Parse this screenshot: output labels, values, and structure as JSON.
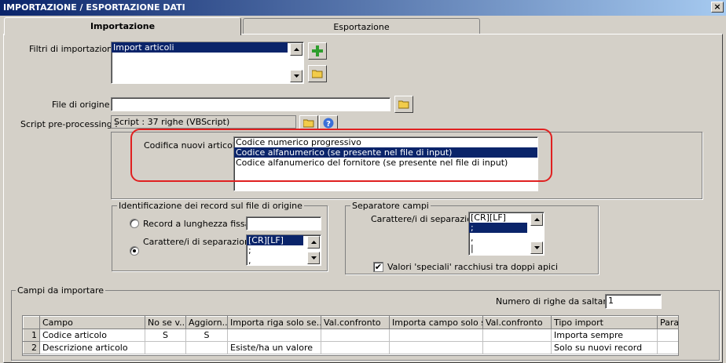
{
  "window": {
    "title": "IMPORTAZIONE / ESPORTAZIONE DATI",
    "close_glyph": "×"
  },
  "tabs": [
    {
      "label": "Importazione",
      "active": true
    },
    {
      "label": "Esportazione",
      "active": false
    }
  ],
  "import_filters": {
    "label": "Filtri di importazione :",
    "items": [
      "Import articoli"
    ],
    "selected_index": 0
  },
  "source_file": {
    "label": "File di origine :",
    "value": ""
  },
  "script": {
    "label": "Script pre-processing :",
    "value": "Script : 37 righe (VBScript)"
  },
  "item_coding": {
    "label": "Codifica nuovi articoli :",
    "options": [
      "Codice numerico progressivo",
      "Codice alfanumerico (se presente nel file di input)",
      "Codice alfanumerico del fornitore (se presente nel file di input)"
    ],
    "selected_index": 1
  },
  "record_ident": {
    "title": "Identificazione dei record sul file di origine",
    "fixed_length_label": "Record a lunghezza fissa",
    "fixed_length_value": "",
    "separator_label": "Carattere/i di separazione",
    "separator_selected": "separator",
    "separators": [
      "[CR][LF]",
      ";",
      ","
    ]
  },
  "field_separator": {
    "title": "Separatore campi",
    "label": "Carattere/i di separazione",
    "separators": [
      "[CR][LF]",
      ";",
      ",",
      "|"
    ],
    "selected_index": 1,
    "quoted_label": "Valori 'speciali' racchiusi tra doppi apici",
    "quoted_checked": true,
    "check_glyph": "✔"
  },
  "fields": {
    "title": "Campi da importare",
    "skip_rows_label": "Numero di righe da saltare :",
    "skip_rows_value": "1",
    "columns": [
      "Campo",
      "No se v...",
      "Aggiorn...",
      "Importa riga solo se...",
      "Val.confronto",
      "Importa campo solo s...",
      "Val.confronto",
      "Tipo import",
      "Para"
    ],
    "rows": [
      {
        "num": "1",
        "cells": [
          "Codice articolo",
          "S",
          "S",
          "",
          "",
          "",
          "",
          "Importa sempre",
          ""
        ]
      },
      {
        "num": "2",
        "cells": [
          "Descrizione articolo",
          "",
          "",
          "Esiste/ha un valore",
          "",
          "",
          "",
          "Solo su nuovi record",
          ""
        ]
      }
    ]
  },
  "icons": {
    "add": "add-icon",
    "folder": "folder-icon",
    "help": "help-icon",
    "scroll_up": "scroll-up-icon",
    "scroll_down": "scroll-down-icon"
  },
  "colors": {
    "selection": "#0a246a",
    "highlight_box": "#e02020",
    "face": "#d4d0c8",
    "add_green": "#2e9e2e",
    "folder_yellow": "#f2cc4a"
  }
}
